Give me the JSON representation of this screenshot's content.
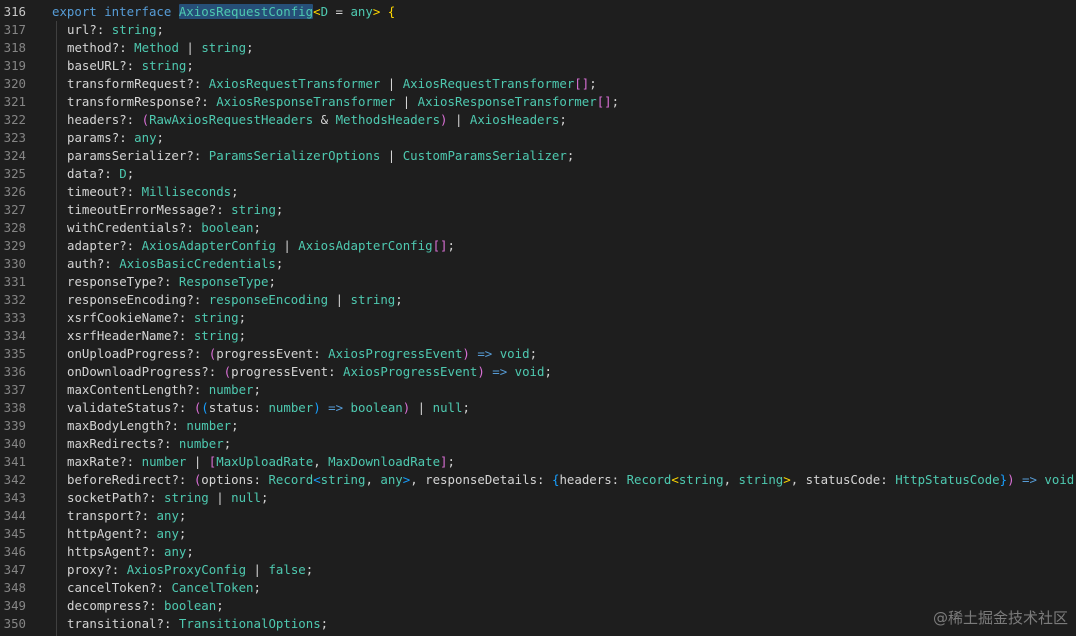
{
  "colors": {
    "background": "#1e1e1e",
    "keyword": "#569cd6",
    "type": "#4ec9b0",
    "property": "#d4d4d4",
    "parameter": "#9cdcfe",
    "bracket_level1": "#ffd700",
    "bracket_level2": "#da70d6",
    "bracket_level3": "#179fff",
    "selection": "#264f78",
    "line_number": "#858585"
  },
  "watermark": "@稀土掘金技术社区",
  "lines": [
    {
      "n": "316",
      "active": true,
      "tokens": [
        {
          "t": "export ",
          "c": "kw"
        },
        {
          "t": "interface ",
          "c": "kw"
        },
        {
          "t": "AxiosRequestConfig",
          "c": "ty",
          "hl": true
        },
        {
          "t": "<",
          "c": "b1"
        },
        {
          "t": "D",
          "c": "ty"
        },
        {
          "t": " = ",
          "c": "pn"
        },
        {
          "t": "any",
          "c": "ty"
        },
        {
          "t": ">",
          "c": "b1"
        },
        {
          "t": " {",
          "c": "b1"
        }
      ]
    },
    {
      "n": "317",
      "tokens": [
        {
          "t": "url",
          "c": "pr"
        },
        {
          "t": "?: ",
          "c": "pn"
        },
        {
          "t": "string",
          "c": "ty"
        },
        {
          "t": ";",
          "c": "pn"
        }
      ]
    },
    {
      "n": "318",
      "tokens": [
        {
          "t": "method",
          "c": "pr"
        },
        {
          "t": "?: ",
          "c": "pn"
        },
        {
          "t": "Method",
          "c": "ty"
        },
        {
          "t": " | ",
          "c": "pn"
        },
        {
          "t": "string",
          "c": "ty"
        },
        {
          "t": ";",
          "c": "pn"
        }
      ]
    },
    {
      "n": "319",
      "tokens": [
        {
          "t": "baseURL",
          "c": "pr"
        },
        {
          "t": "?: ",
          "c": "pn"
        },
        {
          "t": "string",
          "c": "ty"
        },
        {
          "t": ";",
          "c": "pn"
        }
      ]
    },
    {
      "n": "320",
      "tokens": [
        {
          "t": "transformRequest",
          "c": "pr"
        },
        {
          "t": "?: ",
          "c": "pn"
        },
        {
          "t": "AxiosRequestTransformer",
          "c": "ty"
        },
        {
          "t": " | ",
          "c": "pn"
        },
        {
          "t": "AxiosRequestTransformer",
          "c": "ty"
        },
        {
          "t": "[]",
          "c": "b2"
        },
        {
          "t": ";",
          "c": "pn"
        }
      ]
    },
    {
      "n": "321",
      "tokens": [
        {
          "t": "transformResponse",
          "c": "pr"
        },
        {
          "t": "?: ",
          "c": "pn"
        },
        {
          "t": "AxiosResponseTransformer",
          "c": "ty"
        },
        {
          "t": " | ",
          "c": "pn"
        },
        {
          "t": "AxiosResponseTransformer",
          "c": "ty"
        },
        {
          "t": "[]",
          "c": "b2"
        },
        {
          "t": ";",
          "c": "pn"
        }
      ]
    },
    {
      "n": "322",
      "tokens": [
        {
          "t": "headers",
          "c": "pr"
        },
        {
          "t": "?: ",
          "c": "pn"
        },
        {
          "t": "(",
          "c": "b2"
        },
        {
          "t": "RawAxiosRequestHeaders",
          "c": "ty"
        },
        {
          "t": " & ",
          "c": "pn"
        },
        {
          "t": "MethodsHeaders",
          "c": "ty"
        },
        {
          "t": ")",
          "c": "b2"
        },
        {
          "t": " | ",
          "c": "pn"
        },
        {
          "t": "AxiosHeaders",
          "c": "ty"
        },
        {
          "t": ";",
          "c": "pn"
        }
      ]
    },
    {
      "n": "323",
      "tokens": [
        {
          "t": "params",
          "c": "pr"
        },
        {
          "t": "?: ",
          "c": "pn"
        },
        {
          "t": "any",
          "c": "ty"
        },
        {
          "t": ";",
          "c": "pn"
        }
      ]
    },
    {
      "n": "324",
      "tokens": [
        {
          "t": "paramsSerializer",
          "c": "pr"
        },
        {
          "t": "?: ",
          "c": "pn"
        },
        {
          "t": "ParamsSerializerOptions",
          "c": "ty"
        },
        {
          "t": " | ",
          "c": "pn"
        },
        {
          "t": "CustomParamsSerializer",
          "c": "ty"
        },
        {
          "t": ";",
          "c": "pn"
        }
      ]
    },
    {
      "n": "325",
      "tokens": [
        {
          "t": "data",
          "c": "pr"
        },
        {
          "t": "?: ",
          "c": "pn"
        },
        {
          "t": "D",
          "c": "ty"
        },
        {
          "t": ";",
          "c": "pn"
        }
      ]
    },
    {
      "n": "326",
      "tokens": [
        {
          "t": "timeout",
          "c": "pr"
        },
        {
          "t": "?: ",
          "c": "pn"
        },
        {
          "t": "Milliseconds",
          "c": "ty"
        },
        {
          "t": ";",
          "c": "pn"
        }
      ]
    },
    {
      "n": "327",
      "tokens": [
        {
          "t": "timeoutErrorMessage",
          "c": "pr"
        },
        {
          "t": "?: ",
          "c": "pn"
        },
        {
          "t": "string",
          "c": "ty"
        },
        {
          "t": ";",
          "c": "pn"
        }
      ]
    },
    {
      "n": "328",
      "tokens": [
        {
          "t": "withCredentials",
          "c": "pr"
        },
        {
          "t": "?: ",
          "c": "pn"
        },
        {
          "t": "boolean",
          "c": "ty"
        },
        {
          "t": ";",
          "c": "pn"
        }
      ]
    },
    {
      "n": "329",
      "tokens": [
        {
          "t": "adapter",
          "c": "pr"
        },
        {
          "t": "?: ",
          "c": "pn"
        },
        {
          "t": "AxiosAdapterConfig",
          "c": "ty"
        },
        {
          "t": " | ",
          "c": "pn"
        },
        {
          "t": "AxiosAdapterConfig",
          "c": "ty"
        },
        {
          "t": "[]",
          "c": "b2"
        },
        {
          "t": ";",
          "c": "pn"
        }
      ]
    },
    {
      "n": "330",
      "tokens": [
        {
          "t": "auth",
          "c": "pr"
        },
        {
          "t": "?: ",
          "c": "pn"
        },
        {
          "t": "AxiosBasicCredentials",
          "c": "ty"
        },
        {
          "t": ";",
          "c": "pn"
        }
      ]
    },
    {
      "n": "331",
      "tokens": [
        {
          "t": "responseType",
          "c": "pr"
        },
        {
          "t": "?: ",
          "c": "pn"
        },
        {
          "t": "ResponseType",
          "c": "ty"
        },
        {
          "t": ";",
          "c": "pn"
        }
      ]
    },
    {
      "n": "332",
      "tokens": [
        {
          "t": "responseEncoding",
          "c": "pr"
        },
        {
          "t": "?: ",
          "c": "pn"
        },
        {
          "t": "responseEncoding",
          "c": "ty"
        },
        {
          "t": " | ",
          "c": "pn"
        },
        {
          "t": "string",
          "c": "ty"
        },
        {
          "t": ";",
          "c": "pn"
        }
      ]
    },
    {
      "n": "333",
      "tokens": [
        {
          "t": "xsrfCookieName",
          "c": "pr"
        },
        {
          "t": "?: ",
          "c": "pn"
        },
        {
          "t": "string",
          "c": "ty"
        },
        {
          "t": ";",
          "c": "pn"
        }
      ]
    },
    {
      "n": "334",
      "tokens": [
        {
          "t": "xsrfHeaderName",
          "c": "pr"
        },
        {
          "t": "?: ",
          "c": "pn"
        },
        {
          "t": "string",
          "c": "ty"
        },
        {
          "t": ";",
          "c": "pn"
        }
      ]
    },
    {
      "n": "335",
      "tokens": [
        {
          "t": "onUploadProgress",
          "c": "pr"
        },
        {
          "t": "?: ",
          "c": "pn"
        },
        {
          "t": "(",
          "c": "b2"
        },
        {
          "t": "progressEvent",
          "c": "pr"
        },
        {
          "t": ": ",
          "c": "pn"
        },
        {
          "t": "AxiosProgressEvent",
          "c": "ty"
        },
        {
          "t": ")",
          "c": "b2"
        },
        {
          "t": " => ",
          "c": "op"
        },
        {
          "t": "void",
          "c": "ty"
        },
        {
          "t": ";",
          "c": "pn"
        }
      ]
    },
    {
      "n": "336",
      "tokens": [
        {
          "t": "onDownloadProgress",
          "c": "pr"
        },
        {
          "t": "?: ",
          "c": "pn"
        },
        {
          "t": "(",
          "c": "b2"
        },
        {
          "t": "progressEvent",
          "c": "pr"
        },
        {
          "t": ": ",
          "c": "pn"
        },
        {
          "t": "AxiosProgressEvent",
          "c": "ty"
        },
        {
          "t": ")",
          "c": "b2"
        },
        {
          "t": " => ",
          "c": "op"
        },
        {
          "t": "void",
          "c": "ty"
        },
        {
          "t": ";",
          "c": "pn"
        }
      ]
    },
    {
      "n": "337",
      "tokens": [
        {
          "t": "maxContentLength",
          "c": "pr"
        },
        {
          "t": "?: ",
          "c": "pn"
        },
        {
          "t": "number",
          "c": "ty"
        },
        {
          "t": ";",
          "c": "pn"
        }
      ]
    },
    {
      "n": "338",
      "tokens": [
        {
          "t": "validateStatus",
          "c": "pr"
        },
        {
          "t": "?: ",
          "c": "pn"
        },
        {
          "t": "(",
          "c": "b2"
        },
        {
          "t": "(",
          "c": "b3"
        },
        {
          "t": "status",
          "c": "pr"
        },
        {
          "t": ": ",
          "c": "pn"
        },
        {
          "t": "number",
          "c": "ty"
        },
        {
          "t": ")",
          "c": "b3"
        },
        {
          "t": " => ",
          "c": "op"
        },
        {
          "t": "boolean",
          "c": "ty"
        },
        {
          "t": ")",
          "c": "b2"
        },
        {
          "t": " | ",
          "c": "pn"
        },
        {
          "t": "null",
          "c": "ty"
        },
        {
          "t": ";",
          "c": "pn"
        }
      ]
    },
    {
      "n": "339",
      "tokens": [
        {
          "t": "maxBodyLength",
          "c": "pr"
        },
        {
          "t": "?: ",
          "c": "pn"
        },
        {
          "t": "number",
          "c": "ty"
        },
        {
          "t": ";",
          "c": "pn"
        }
      ]
    },
    {
      "n": "340",
      "tokens": [
        {
          "t": "maxRedirects",
          "c": "pr"
        },
        {
          "t": "?: ",
          "c": "pn"
        },
        {
          "t": "number",
          "c": "ty"
        },
        {
          "t": ";",
          "c": "pn"
        }
      ]
    },
    {
      "n": "341",
      "tokens": [
        {
          "t": "maxRate",
          "c": "pr"
        },
        {
          "t": "?: ",
          "c": "pn"
        },
        {
          "t": "number",
          "c": "ty"
        },
        {
          "t": " | ",
          "c": "pn"
        },
        {
          "t": "[",
          "c": "b2"
        },
        {
          "t": "MaxUploadRate",
          "c": "ty"
        },
        {
          "t": ", ",
          "c": "pn"
        },
        {
          "t": "MaxDownloadRate",
          "c": "ty"
        },
        {
          "t": "]",
          "c": "b2"
        },
        {
          "t": ";",
          "c": "pn"
        }
      ]
    },
    {
      "n": "342",
      "tokens": [
        {
          "t": "beforeRedirect",
          "c": "pr"
        },
        {
          "t": "?: ",
          "c": "pn"
        },
        {
          "t": "(",
          "c": "b2"
        },
        {
          "t": "options",
          "c": "pr"
        },
        {
          "t": ": ",
          "c": "pn"
        },
        {
          "t": "Record",
          "c": "ty"
        },
        {
          "t": "<",
          "c": "b3"
        },
        {
          "t": "string",
          "c": "ty"
        },
        {
          "t": ", ",
          "c": "pn"
        },
        {
          "t": "any",
          "c": "ty"
        },
        {
          "t": ">",
          "c": "b3"
        },
        {
          "t": ", ",
          "c": "pn"
        },
        {
          "t": "responseDetails",
          "c": "pr"
        },
        {
          "t": ": ",
          "c": "pn"
        },
        {
          "t": "{",
          "c": "b3"
        },
        {
          "t": "headers",
          "c": "pr"
        },
        {
          "t": ": ",
          "c": "pn"
        },
        {
          "t": "Record",
          "c": "ty"
        },
        {
          "t": "<",
          "c": "b1"
        },
        {
          "t": "string",
          "c": "ty"
        },
        {
          "t": ", ",
          "c": "pn"
        },
        {
          "t": "string",
          "c": "ty"
        },
        {
          "t": ">",
          "c": "b1"
        },
        {
          "t": ", ",
          "c": "pn"
        },
        {
          "t": "statusCode",
          "c": "pr"
        },
        {
          "t": ": ",
          "c": "pn"
        },
        {
          "t": "HttpStatusCode",
          "c": "ty"
        },
        {
          "t": "}",
          "c": "b3"
        },
        {
          "t": ")",
          "c": "b2"
        },
        {
          "t": " => ",
          "c": "op"
        },
        {
          "t": "void",
          "c": "ty"
        },
        {
          "t": ";",
          "c": "pn"
        }
      ]
    },
    {
      "n": "343",
      "tokens": [
        {
          "t": "socketPath",
          "c": "pr"
        },
        {
          "t": "?: ",
          "c": "pn"
        },
        {
          "t": "string",
          "c": "ty"
        },
        {
          "t": " | ",
          "c": "pn"
        },
        {
          "t": "null",
          "c": "ty"
        },
        {
          "t": ";",
          "c": "pn"
        }
      ]
    },
    {
      "n": "344",
      "tokens": [
        {
          "t": "transport",
          "c": "pr"
        },
        {
          "t": "?: ",
          "c": "pn"
        },
        {
          "t": "any",
          "c": "ty"
        },
        {
          "t": ";",
          "c": "pn"
        }
      ]
    },
    {
      "n": "345",
      "tokens": [
        {
          "t": "httpAgent",
          "c": "pr"
        },
        {
          "t": "?: ",
          "c": "pn"
        },
        {
          "t": "any",
          "c": "ty"
        },
        {
          "t": ";",
          "c": "pn"
        }
      ]
    },
    {
      "n": "346",
      "tokens": [
        {
          "t": "httpsAgent",
          "c": "pr"
        },
        {
          "t": "?: ",
          "c": "pn"
        },
        {
          "t": "any",
          "c": "ty"
        },
        {
          "t": ";",
          "c": "pn"
        }
      ]
    },
    {
      "n": "347",
      "tokens": [
        {
          "t": "proxy",
          "c": "pr"
        },
        {
          "t": "?: ",
          "c": "pn"
        },
        {
          "t": "AxiosProxyConfig",
          "c": "ty"
        },
        {
          "t": " | ",
          "c": "pn"
        },
        {
          "t": "false",
          "c": "ty"
        },
        {
          "t": ";",
          "c": "pn"
        }
      ]
    },
    {
      "n": "348",
      "tokens": [
        {
          "t": "cancelToken",
          "c": "pr"
        },
        {
          "t": "?: ",
          "c": "pn"
        },
        {
          "t": "CancelToken",
          "c": "ty"
        },
        {
          "t": ";",
          "c": "pn"
        }
      ]
    },
    {
      "n": "349",
      "tokens": [
        {
          "t": "decompress",
          "c": "pr"
        },
        {
          "t": "?: ",
          "c": "pn"
        },
        {
          "t": "boolean",
          "c": "ty"
        },
        {
          "t": ";",
          "c": "pn"
        }
      ]
    },
    {
      "n": "350",
      "tokens": [
        {
          "t": "transitional",
          "c": "pr"
        },
        {
          "t": "?: ",
          "c": "pn"
        },
        {
          "t": "TransitionalOptions",
          "c": "ty"
        },
        {
          "t": ";",
          "c": "pn"
        }
      ]
    }
  ]
}
